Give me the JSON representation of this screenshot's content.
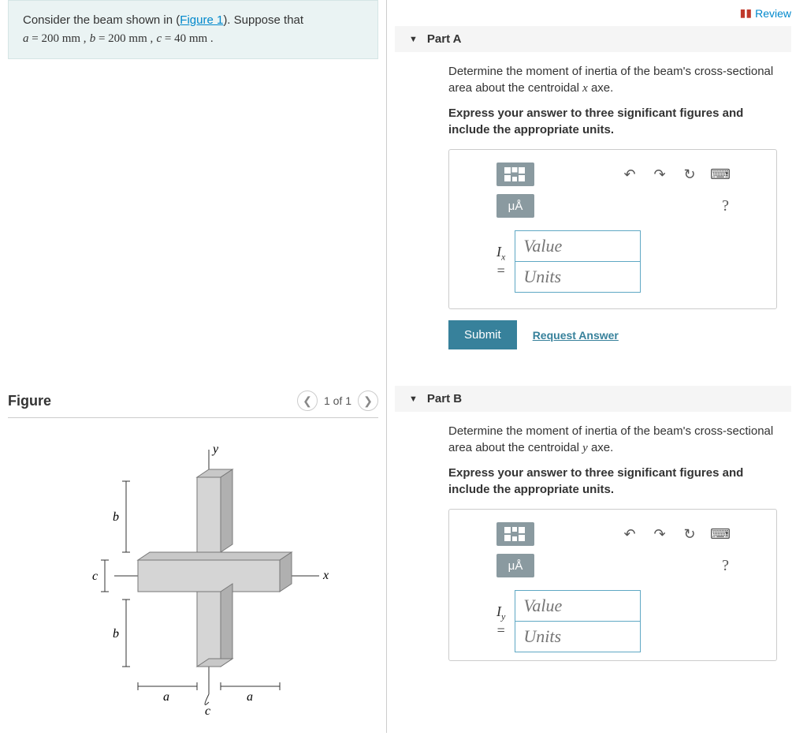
{
  "problem": {
    "prefix": "Consider the beam shown in (",
    "figure_link": "Figure 1",
    "suffix": "). Suppose that",
    "eq_a_var": "a",
    "eq_a_val": " = 200  mm ,",
    "eq_b_var": " b",
    "eq_b_val": " = 200  mm ,",
    "eq_c_var": " c",
    "eq_c_val": " = 40  mm ."
  },
  "figure": {
    "title": "Figure",
    "counter": "1 of 1",
    "labels": {
      "y": "y",
      "x": "x",
      "a": "a",
      "b": "b",
      "c": "c"
    }
  },
  "review": "Review",
  "parts": {
    "a": {
      "title": "Part A",
      "question": "Determine the moment of inertia of the beam's cross-sectional area about the centroidal x axe.",
      "question_var": "x",
      "instruction": "Express your answer to three significant figures and include the appropriate units.",
      "mu": "μÅ",
      "var_sym": "I",
      "var_sub": "x",
      "equals": "=",
      "value_ph": "Value",
      "units_ph": "Units",
      "submit": "Submit",
      "request": "Request Answer"
    },
    "b": {
      "title": "Part B",
      "question": "Determine the moment of inertia of the beam's cross-sectional area about the centroidal y axe.",
      "question_var": "y",
      "instruction": "Express your answer to three significant figures and include the appropriate units.",
      "mu": "μÅ",
      "var_sym": "I",
      "var_sub": "y",
      "equals": "=",
      "value_ph": "Value",
      "units_ph": "Units"
    }
  }
}
